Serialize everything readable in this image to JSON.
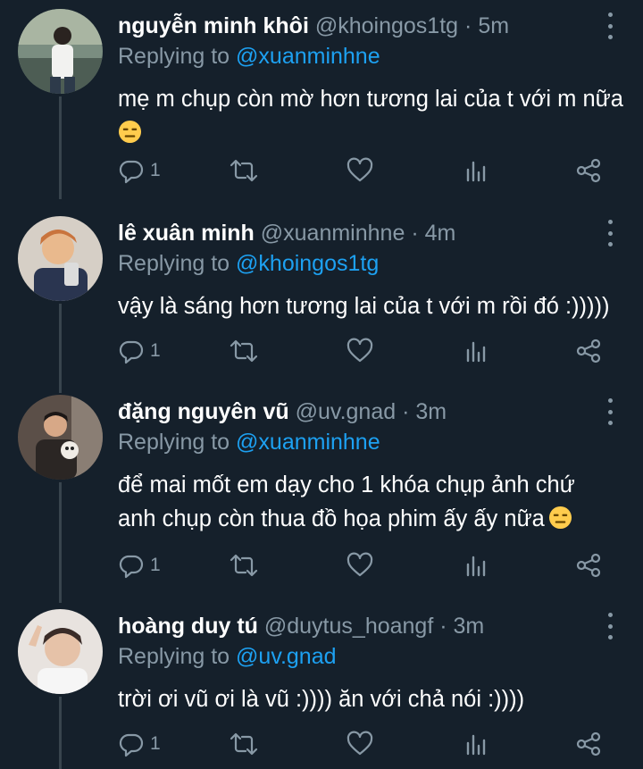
{
  "colors": {
    "background": "#15202b",
    "secondary_text": "#8899a6",
    "accent": "#1da1f2",
    "thread_line": "#38444d"
  },
  "replying_prefix": "Replying to",
  "tweets": [
    {
      "name": "nguyễn minh khôi",
      "handle": "@khoingos1tg",
      "dot": "·",
      "time": "5m",
      "replying_to": "@xuanminhne",
      "body_lines": [
        "mẹ m chụp còn mờ hơn tương lai của t với m nữa",
        ""
      ],
      "emoji": "expressionless-face",
      "reply_count": "1"
    },
    {
      "name": "lê xuân minh",
      "handle": "@xuanminhne",
      "dot": "·",
      "time": "4m",
      "replying_to": "@khoingos1tg",
      "body_lines": [
        "vậy là sáng hơn tương lai của t với m rồi đó :)))))"
      ],
      "reply_count": "1"
    },
    {
      "name": "đặng nguyên vũ",
      "handle": "@uv.gnad",
      "dot": "·",
      "time": "3m",
      "replying_to": "@xuanminhne",
      "body_lines": [
        "để mai mốt em dạy cho 1 khóa chụp ảnh chứ",
        "anh chụp còn thua đồ họa phim ấy ấy nữa"
      ],
      "emoji": "expressionless-face",
      "reply_count": "1"
    },
    {
      "name": "hoàng duy tú",
      "handle": "@duytus_hoangf",
      "dot": "·",
      "time": "3m",
      "replying_to": "@uv.gnad",
      "body_lines": [
        "trời ơi vũ ơi là vũ :)))) ăn với chả nói :))))"
      ],
      "reply_count": "1"
    }
  ]
}
